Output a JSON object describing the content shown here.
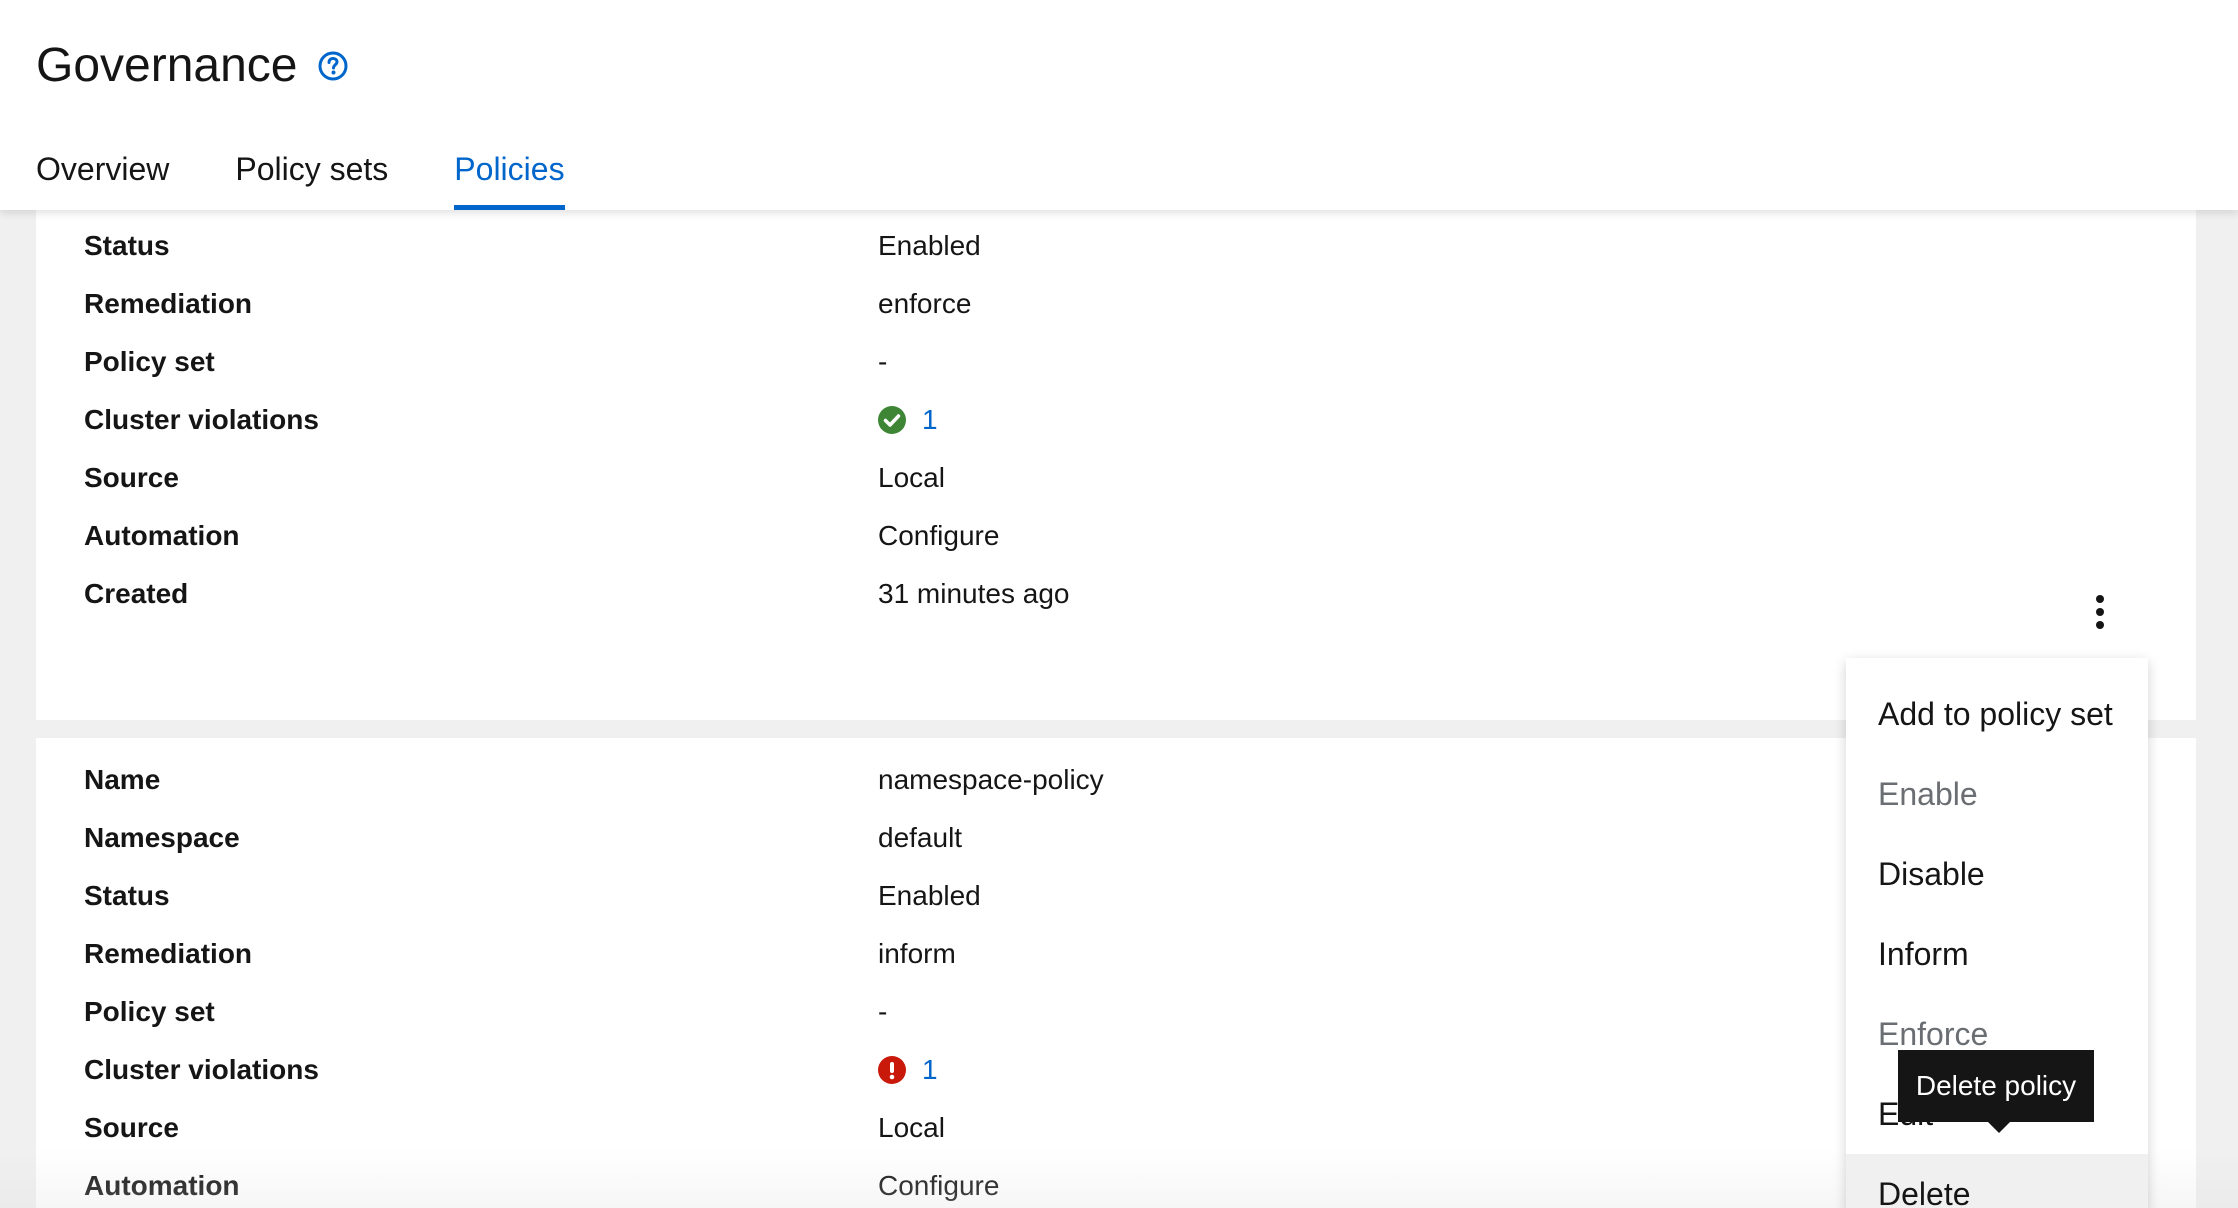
{
  "page": {
    "title": "Governance",
    "help_icon": "question-circle-icon"
  },
  "tabs": [
    {
      "label": "Overview",
      "active": false
    },
    {
      "label": "Policy sets",
      "active": false
    },
    {
      "label": "Policies",
      "active": true
    }
  ],
  "policy_card_1": {
    "rows": [
      {
        "label": "Status",
        "value": "Enabled"
      },
      {
        "label": "Remediation",
        "value": "enforce"
      },
      {
        "label": "Policy set",
        "value": "-"
      },
      {
        "label": "Cluster violations",
        "value": "1",
        "icon": "check-circle-icon"
      },
      {
        "label": "Source",
        "value": "Local"
      },
      {
        "label": "Automation",
        "value": "Configure"
      },
      {
        "label": "Created",
        "value": "31 minutes ago"
      }
    ]
  },
  "policy_card_2": {
    "rows": [
      {
        "label": "Name",
        "value": "namespace-policy"
      },
      {
        "label": "Namespace",
        "value": "default"
      },
      {
        "label": "Status",
        "value": "Enabled"
      },
      {
        "label": "Remediation",
        "value": "inform"
      },
      {
        "label": "Policy set",
        "value": "-"
      },
      {
        "label": "Cluster violations",
        "value": "1",
        "icon": "exclamation-circle-icon"
      },
      {
        "label": "Source",
        "value": "Local"
      },
      {
        "label": "Automation",
        "value": "Configure"
      }
    ]
  },
  "actions_menu": {
    "icon": "kebab-menu-icon",
    "items": [
      {
        "label": "Add to policy set",
        "disabled": false
      },
      {
        "label": "Enable",
        "disabled": true
      },
      {
        "label": "Disable",
        "disabled": false
      },
      {
        "label": "Inform",
        "disabled": false
      },
      {
        "label": "Enforce",
        "disabled": true
      },
      {
        "label": "Edit",
        "disabled": false
      },
      {
        "label": "Delete",
        "disabled": false
      }
    ]
  },
  "tooltip": {
    "text": "Delete policy"
  },
  "colors": {
    "link": "#0066cc",
    "success": "#3e8635",
    "danger": "#c9190b",
    "text": "#151515",
    "disabled": "#6a6e73",
    "background": "#f0f0f0"
  }
}
